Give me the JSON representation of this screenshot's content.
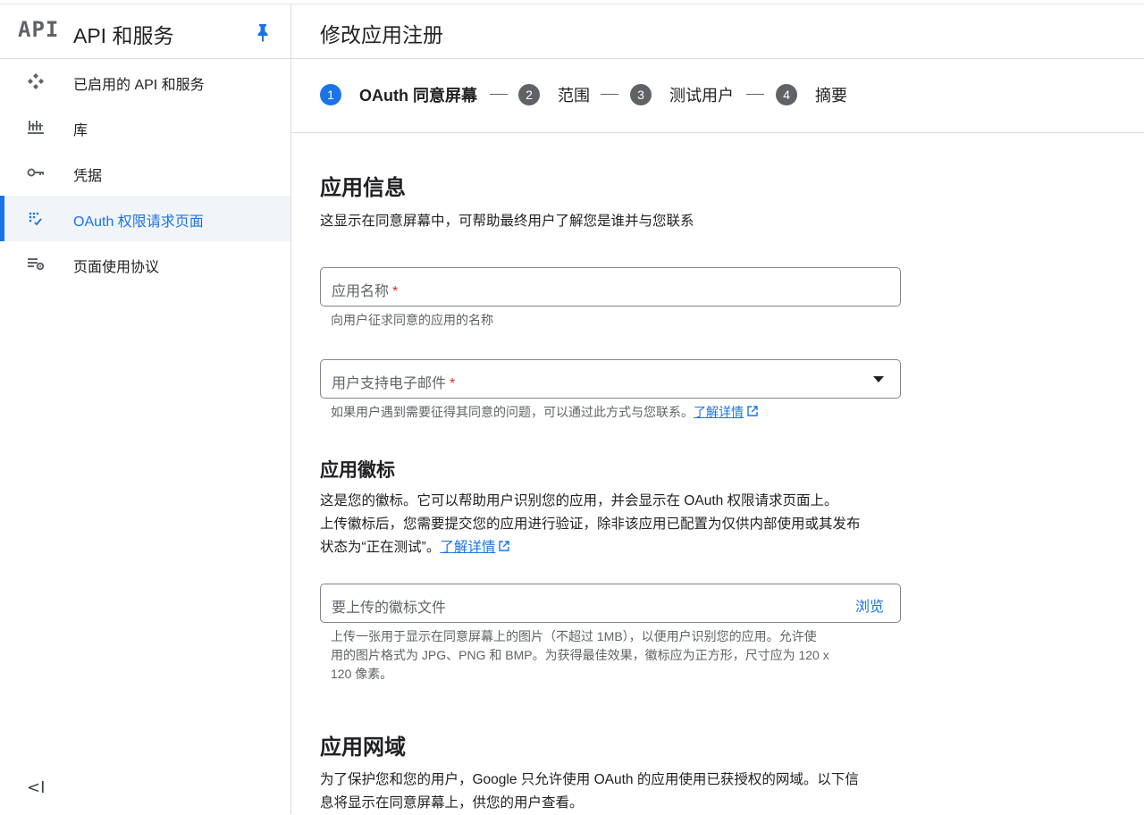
{
  "sidebar": {
    "logo_text": "API",
    "title": "API 和服务",
    "items": [
      {
        "label": "已启用的 API 和服务",
        "icon": "diamond-grid-icon"
      },
      {
        "label": "库",
        "icon": "library-icon"
      },
      {
        "label": "凭据",
        "icon": "key-icon"
      },
      {
        "label": "OAuth 权限请求页面",
        "icon": "oauth-consent-icon"
      },
      {
        "label": "页面使用协议",
        "icon": "page-settings-icon"
      }
    ],
    "active_index": 3,
    "collapse_label": "<I"
  },
  "header": {
    "title": "修改应用注册"
  },
  "stepper": {
    "steps": [
      {
        "number": "1",
        "label": "OAuth 同意屏幕"
      },
      {
        "number": "2",
        "label": "范围"
      },
      {
        "number": "3",
        "label": "测试用户"
      },
      {
        "number": "4",
        "label": "摘要"
      }
    ],
    "active_step": 1
  },
  "app_info": {
    "title": "应用信息",
    "description": "这显示在同意屏幕中，可帮助最终用户了解您是谁并与您联系",
    "app_name_label": "应用名称",
    "app_name_value": "",
    "app_name_hint": "向用户征求同意的应用的名称",
    "email_label": "用户支持电子邮件",
    "email_value": "",
    "email_hint": "如果用户遇到需要征得其同意的问题，可以通过此方式与您联系。",
    "learn_more": "了解详情"
  },
  "app_logo": {
    "title": "应用徽标",
    "description_line1": "这是您的徽标。它可以帮助用户识别您的应用，并会显示在 OAuth 权限请求页面上。",
    "description_line2": "上传徽标后，您需要提交您的应用进行验证，除非该应用已配置为仅供内部使用或其发布",
    "description_line3": "状态为“正在测试”。",
    "learn_more": "了解详情",
    "file_label": "要上传的徽标文件",
    "browse_label": "浏览",
    "hint_line1": "上传一张用于显示在同意屏幕上的图片（不超过 1MB），以便用户识别您的应用。允许使",
    "hint_line2": "用的图片格式为 JPG、PNG 和 BMP。为获得最佳效果，徽标应为正方形，尺寸应为 120 x",
    "hint_line3": "120 像素。"
  },
  "app_domain": {
    "title": "应用网域",
    "description_line1": "为了保护您和您的用户，Google 只允许使用 OAuth 的应用使用已获授权的网域。以下信",
    "description_line2": "息将显示在同意屏幕上，供您的用户查看。"
  },
  "colors": {
    "accent": "#1a73e8",
    "required": "#d93025",
    "step_inactive": "#5f6368"
  }
}
